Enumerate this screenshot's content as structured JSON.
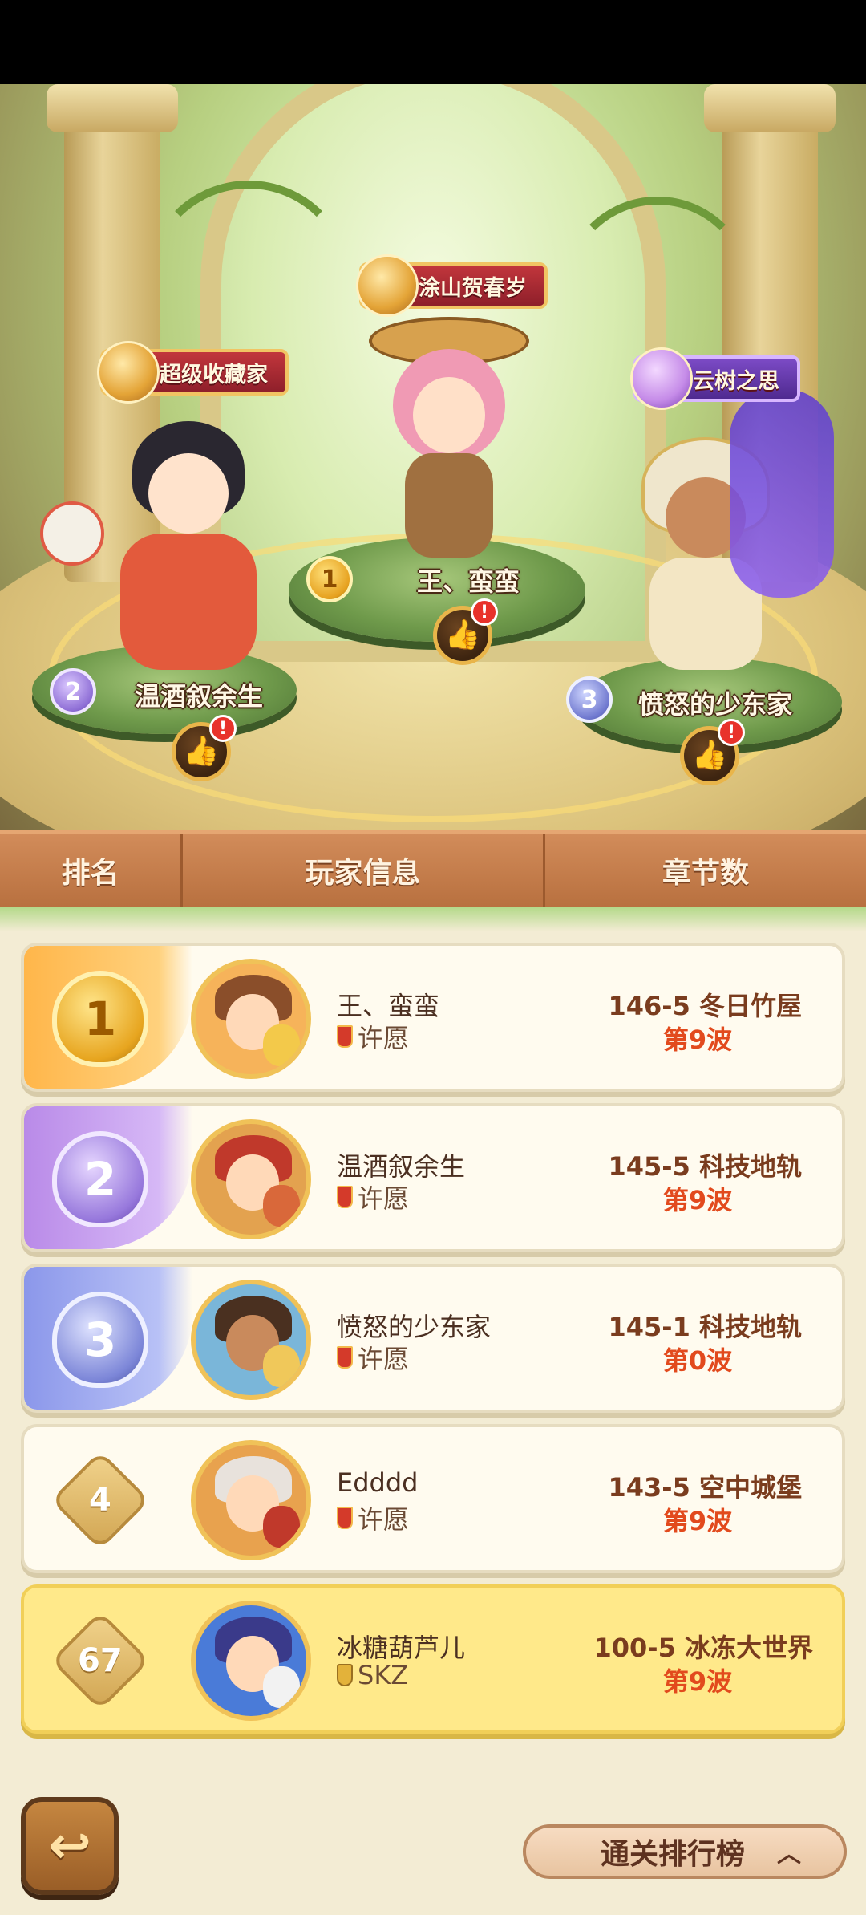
{
  "podium": {
    "first": {
      "rank": "1",
      "name": "王、蛮蛮",
      "title": "涂山贺春岁"
    },
    "second": {
      "rank": "2",
      "name": "温酒叙余生",
      "title": "超级收藏家"
    },
    "third": {
      "rank": "3",
      "name": "愤怒的少东家",
      "title": "云树之思"
    },
    "like_icon": "thumbs-up-icon",
    "alert_mark": "!"
  },
  "table_header": {
    "rank": "排名",
    "player": "玩家信息",
    "chapter": "章节数"
  },
  "rows": [
    {
      "rank": "1",
      "name": "王、蛮蛮",
      "guild": "许愿",
      "stage": "146-5 冬日竹屋",
      "wave": "第9波"
    },
    {
      "rank": "2",
      "name": "温酒叙余生",
      "guild": "许愿",
      "stage": "145-5 科技地轨",
      "wave": "第9波"
    },
    {
      "rank": "3",
      "name": "愤怒的少东家",
      "guild": "许愿",
      "stage": "145-1 科技地轨",
      "wave": "第0波"
    },
    {
      "rank": "4",
      "name": "Edddd",
      "guild": "许愿",
      "stage": "143-5 空中城堡",
      "wave": "第9波"
    },
    {
      "rank": "67",
      "name": "冰糖葫芦儿",
      "guild": "SKZ",
      "stage": "100-5 冰冻大世界",
      "wave": "第9波"
    }
  ],
  "bottom": {
    "back_icon": "back-arrow-icon",
    "toggle_label": "通关排行榜",
    "toggle_icon": "chevron-up-icon"
  },
  "colors": {
    "header_bg": "#c47e4b",
    "self_row": "#ffe98a",
    "wave_text": "#e24a1d"
  }
}
